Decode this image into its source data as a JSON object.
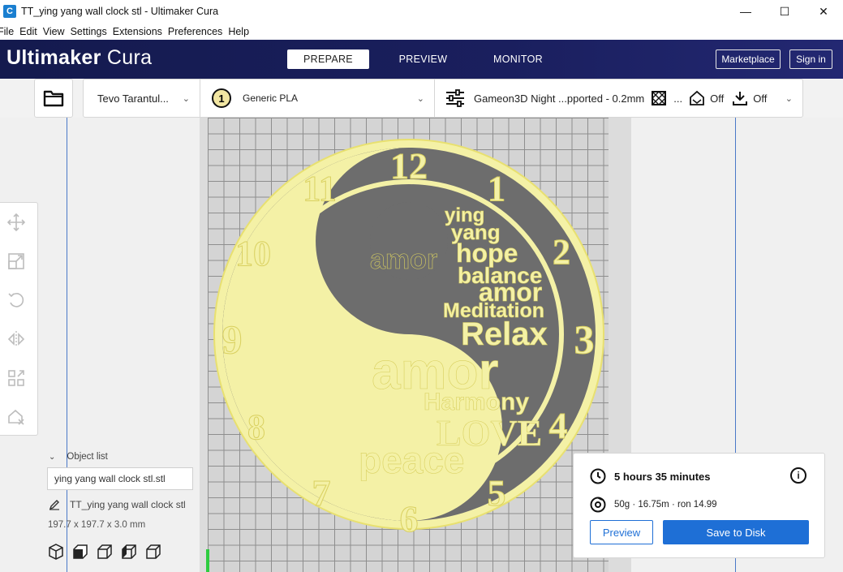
{
  "window": {
    "title": "TT_ying yang wall clock stl - Ultimaker Cura",
    "app_icon": "C",
    "controls": {
      "minimize": "—",
      "maximize": "☐",
      "close": "✕"
    }
  },
  "menubar": {
    "items": [
      "File",
      "Edit",
      "View",
      "Settings",
      "Extensions",
      "Preferences",
      "Help"
    ]
  },
  "header": {
    "brand_bold": "Ultimaker",
    "brand_light": " Cura",
    "tabs": [
      {
        "label": "PREPARE",
        "active": true
      },
      {
        "label": "PREVIEW",
        "active": false
      },
      {
        "label": "MONITOR",
        "active": false
      }
    ],
    "marketplace_label": "Marketplace",
    "signin_label": "Sign in"
  },
  "toolbar": {
    "open_icon": "folder-icon",
    "printer": "Tevo Tarantul...",
    "extruder_number": "1",
    "material": "Generic PLA",
    "profile": "Gameon3D Night ...pported - 0.2mm",
    "infill_ellipsis": "...",
    "support": "Off",
    "adhesion": "Off"
  },
  "tools": [
    "move-icon",
    "scale-icon",
    "rotate-icon",
    "mirror-icon",
    "per-model-settings-icon",
    "support-blocker-icon"
  ],
  "object_list": {
    "header": "Object list",
    "selected_file": "ying yang wall clock stl.stl",
    "object_name": "TT_ying yang wall clock stl",
    "dimensions": "197.7 x 197.7 x 3.0 mm"
  },
  "view_buttons": [
    "3d-view-icon",
    "front-view-icon",
    "top-view-icon",
    "left-view-icon",
    "right-view-icon"
  ],
  "print_info": {
    "time": "5 hours 35 minutes",
    "usage": "50g · 16.75m · ron 14.99",
    "preview_label": "Preview",
    "save_label": "Save to Disk"
  },
  "model": {
    "numbers": [
      "12",
      "1",
      "2",
      "3",
      "4",
      "5",
      "6",
      "7",
      "8",
      "9",
      "10",
      "11"
    ],
    "words": [
      "ying",
      "yang",
      "amor",
      "hope",
      "balance",
      "amor",
      "Meditation",
      "Relax",
      "amor",
      "Harmony",
      "LOVE",
      "peace"
    ],
    "colors": {
      "model": "#f4f1a6",
      "model_outline": "#e8e070",
      "dark_area": "#6d6d6d",
      "accent": "#1e6fd6",
      "header": "#171c54"
    }
  }
}
